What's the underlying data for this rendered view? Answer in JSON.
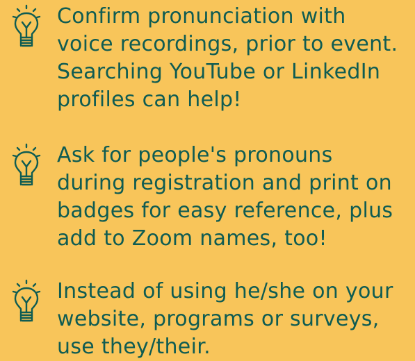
{
  "tips": [
    {
      "icon": "lightbulb-icon",
      "text": "Confirm pronunciation with\nvoice recordings, prior to event.\nSearching YouTube or LinkedIn\nprofiles can help!"
    },
    {
      "icon": "lightbulb-icon",
      "text": "Ask for people's pronouns\nduring registration and print on\nbadges for easy reference, plus\nadd to Zoom names, too!"
    },
    {
      "icon": "lightbulb-icon",
      "text": "Instead of using he/she on your\nwebsite, programs or surveys,\nuse they/their."
    }
  ],
  "colors": {
    "background": "#f8c55a",
    "text": "#0f5c52",
    "icon": "#0f5c52"
  }
}
